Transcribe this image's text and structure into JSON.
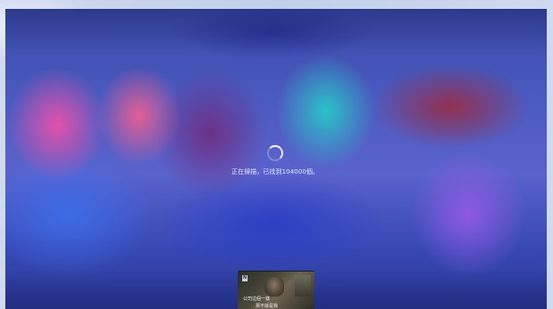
{
  "scan": {
    "status_text": "正在掃描，已找到104000個。"
  },
  "preview": {
    "badge": "N",
    "subtitle_line_1": "公司這個一樣",
    "subtitle_line_2": "那不就是我"
  },
  "colors": {
    "accent": "#5a63cc",
    "text": "#eef1ff"
  },
  "icons": {
    "loading": "loading-spinner-icon"
  }
}
